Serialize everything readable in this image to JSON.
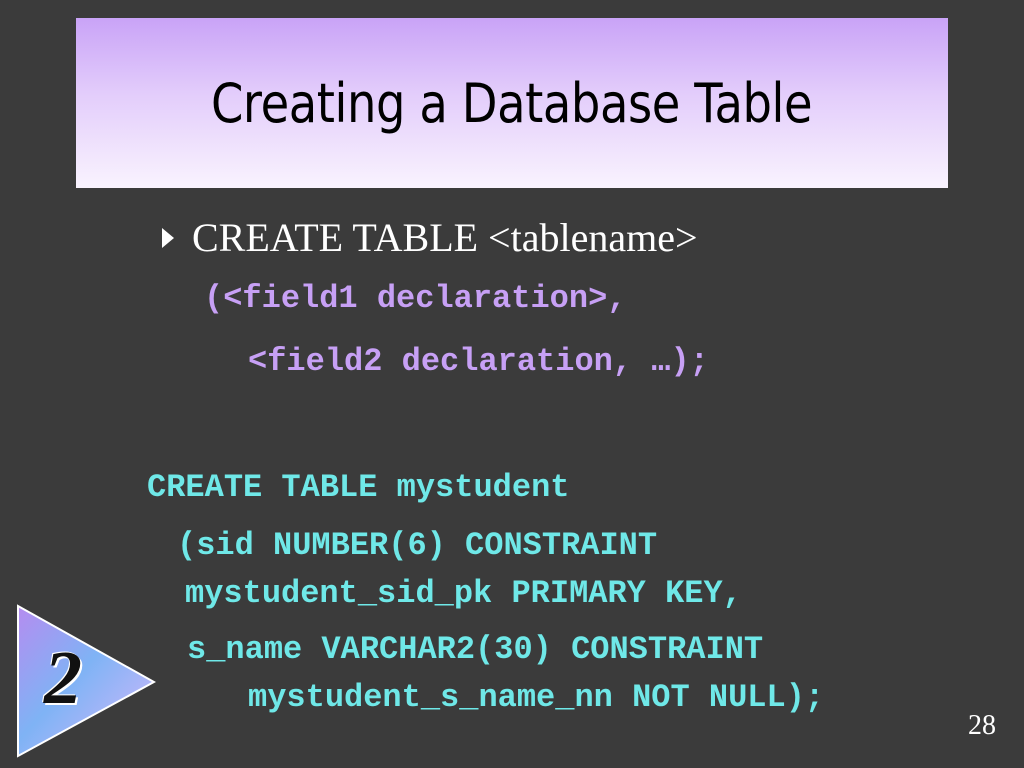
{
  "slide": {
    "title": "Creating a Database Table",
    "bullet": "CREATE TABLE <tablename>",
    "syntax": [
      "(<field1 declaration>,",
      "<field2 declaration, …);"
    ],
    "example": [
      "CREATE TABLE mystudent",
      "(sid NUMBER(6) CONSTRAINT",
      "mystudent_sid_pk PRIMARY KEY,",
      "s_name VARCHAR2(30) CONSTRAINT",
      "mystudent_s_name_nn NOT NULL);"
    ],
    "badge_number": "2",
    "page_number": "28"
  },
  "icons": {
    "bullet": "triangle-bullet-icon",
    "badge": "triangle-badge-icon"
  },
  "colors": {
    "background": "#3b3b3b",
    "title_gradient_top": "#c9a3f7",
    "title_gradient_bottom": "#f9f3fe",
    "syntax_text": "#c7a0f5",
    "example_text": "#6fe8e8",
    "body_text": "#ffffff"
  }
}
